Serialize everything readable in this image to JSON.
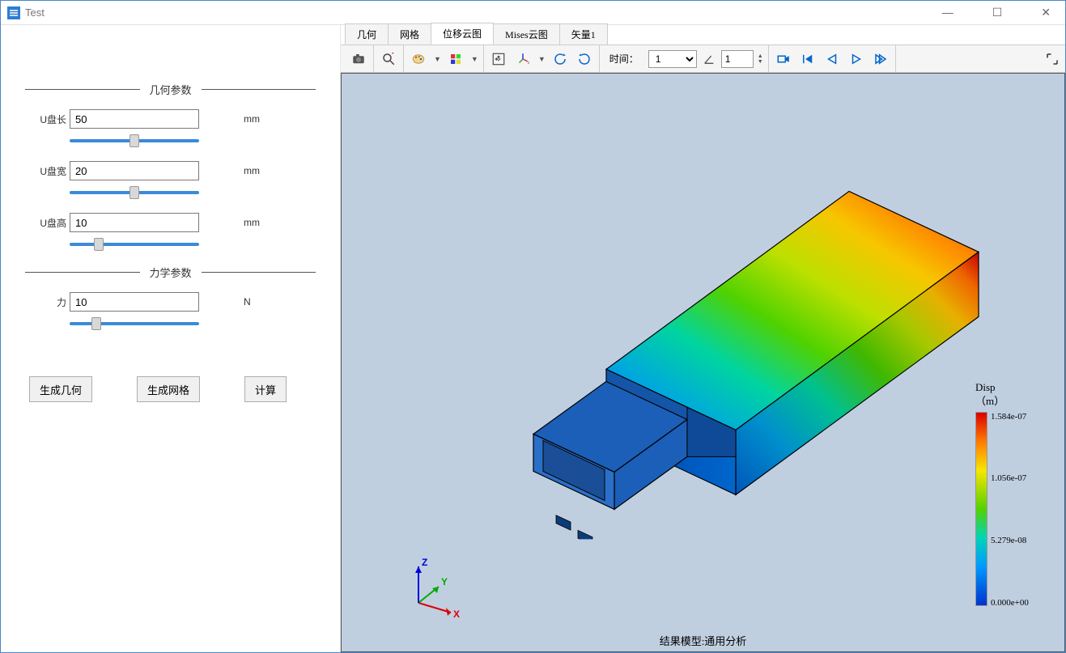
{
  "window": {
    "title": "Test"
  },
  "sections": {
    "geom_title": "几何参数",
    "mech_title": "力学参数"
  },
  "params": {
    "length": {
      "label": "U盘长",
      "value": "50",
      "unit": "mm"
    },
    "width": {
      "label": "U盘宽",
      "value": "20",
      "unit": "mm"
    },
    "height": {
      "label": "U盘高",
      "value": "10",
      "unit": "mm"
    },
    "force": {
      "label": "力",
      "value": "10",
      "unit": "N"
    }
  },
  "buttons": {
    "gen_geom": "生成几何",
    "gen_mesh": "生成网格",
    "compute": "计算"
  },
  "tabs": [
    "几何",
    "网格",
    "位移云图",
    "Mises云图",
    "矢量1"
  ],
  "active_tab": "位移云图",
  "toolbar": {
    "time_label": "时间：",
    "time_value": "1",
    "time_step": "1"
  },
  "legend": {
    "title_l1": "Disp",
    "title_l2": "（m）",
    "ticks": [
      "1.584e-07",
      "1.056e-07",
      "5.279e-08",
      "0.000e+00"
    ]
  },
  "footer": "结果模型:通用分析",
  "axes": {
    "x": "X",
    "y": "Y",
    "z": "Z"
  }
}
